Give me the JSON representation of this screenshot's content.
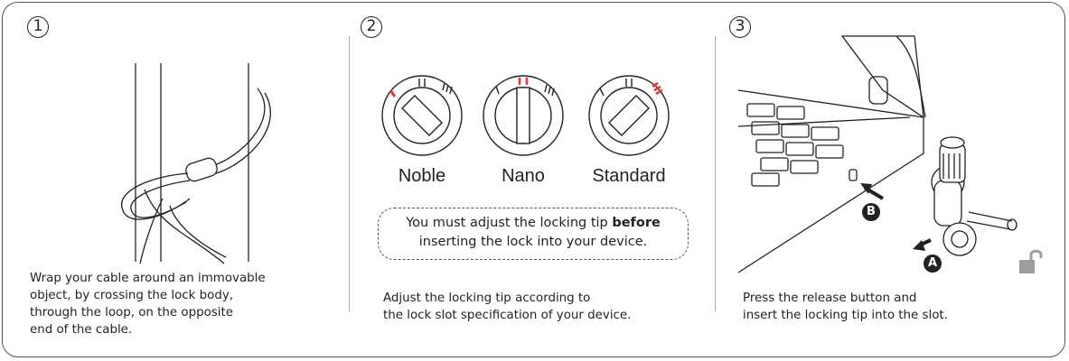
{
  "steps": [
    {
      "number": "1",
      "caption_lines": [
        "Wrap your cable around an immovable",
        "object, by crossing the lock body,",
        "through the loop, on the opposite",
        "end of the cable."
      ]
    },
    {
      "number": "2",
      "dial_labels": [
        "Noble",
        "Nano",
        "Standard"
      ],
      "note": {
        "before": "You must adjust the locking tip ",
        "bold": "before",
        "after": "inserting the lock into your device."
      },
      "caption_lines": [
        "Adjust the locking tip according to",
        "the lock slot specification of your device."
      ]
    },
    {
      "number": "3",
      "callouts": [
        "B",
        "A"
      ],
      "caption_lines": [
        "Press the release button and",
        "insert the locking tip into the slot."
      ]
    }
  ],
  "colors": {
    "accent": "#e53935",
    "ink": "#222222",
    "lock_icon": "#9e9e9e"
  },
  "icons": [
    "cable-loop-icon",
    "lock-dial-icon",
    "laptop-icon",
    "unlocked-padlock-icon"
  ]
}
